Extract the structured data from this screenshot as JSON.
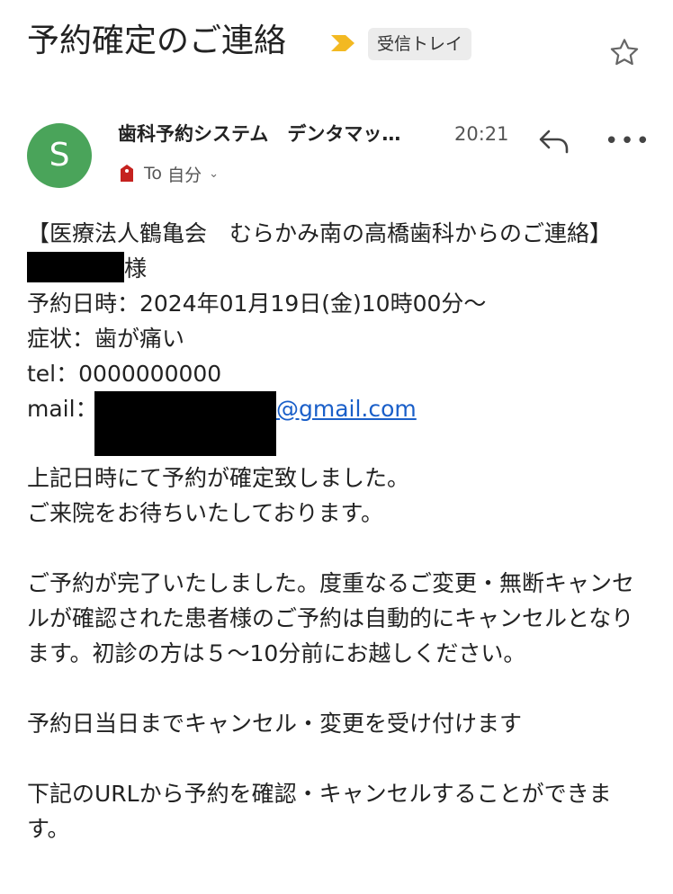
{
  "email": {
    "subject": "予約確定のご連絡",
    "label": "受信トレイ",
    "sender_initial": "S",
    "sender": "歯科予約システム　デンタマッ…",
    "time": "20:21",
    "to_prefix": "To",
    "to_name": "自分",
    "icons": {
      "important": "importance-marker-icon",
      "star": "star-icon",
      "reply": "reply-icon",
      "more": "more-options-icon",
      "tag": "tag-icon",
      "expand": "chevron-down-icon"
    }
  },
  "body": {
    "line1": "【医療法人鶴亀会　むらかみ南の高橋歯科からのご連絡】",
    "name_suffix": "様",
    "date_line": "予約日時：2024年01月19日(金)10時00分～",
    "symptom_line": "症状：歯が痛い",
    "tel_line": "tel：0000000000",
    "mail_label": "mail：",
    "mail_domain": "@gmail.com",
    "confirm_line1": "上記日時にて予約が確定致しました。",
    "confirm_line2": "ご来院をお待ちいたしております。",
    "notice": "ご予約が完了いたしました。度重なるご変更・無断キャンセルが確認された患者様のご予約は自動的にキャンセルとなります。初診の方は５～10分前にお越しください。",
    "cancel_line": "予約日当日までキャンセル・変更を受け付けます",
    "url_line": "下記のURLから予約を確認・キャンセルすることができます。"
  },
  "colors": {
    "avatar": "#4aa45a",
    "link": "#1a5fc9",
    "important": "#f3b922"
  }
}
